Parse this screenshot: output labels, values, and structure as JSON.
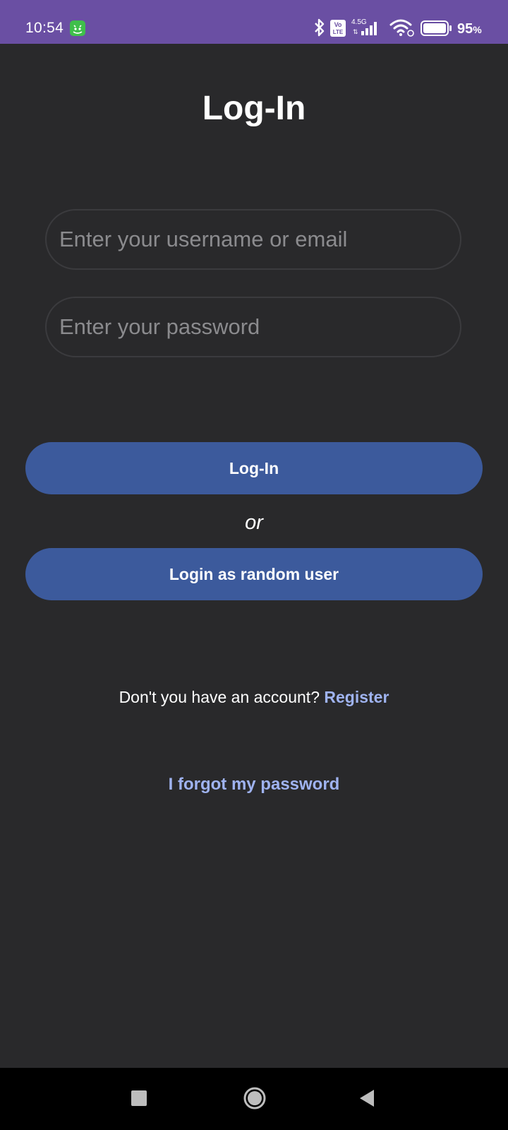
{
  "status_bar": {
    "time": "10:54",
    "network_label": "4.5G",
    "volte_label": "Vo LTE",
    "battery_percent": "95",
    "battery_pct_sign": "%",
    "background_color": "#6a4fa3"
  },
  "page": {
    "title": "Log-In"
  },
  "form": {
    "username_placeholder": "Enter your username or email",
    "password_placeholder": "Enter your password"
  },
  "buttons": {
    "login_label": "Log-In",
    "or_text": "or",
    "random_login_label": "Login as random user",
    "color": "#3c5a9c"
  },
  "links": {
    "register_prompt": "Don't you have an account?",
    "register_label": "Register",
    "forgot_label": "I forgot my password",
    "color": "#9fb3f0"
  },
  "nav_bar": {
    "icons": [
      "recents-icon",
      "home-icon",
      "back-icon"
    ]
  },
  "colors": {
    "background": "#29292b"
  }
}
